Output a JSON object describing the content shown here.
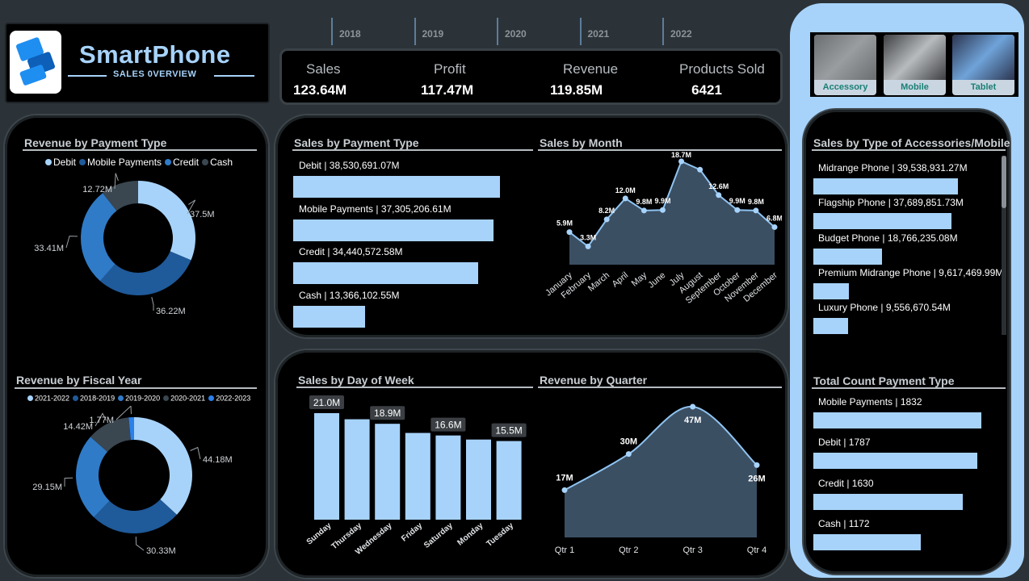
{
  "brand": {
    "title": "SmartPhone",
    "subtitle": "SALES 0VERVIEW"
  },
  "years": [
    "2018",
    "2019",
    "2020",
    "2021",
    "2022"
  ],
  "kpis": [
    {
      "label": "Sales",
      "value": "123.64M"
    },
    {
      "label": "Profit",
      "value": "117.47M"
    },
    {
      "label": "Revenue",
      "value": "119.85M"
    },
    {
      "label": "Products Sold",
      "value": "6421"
    }
  ],
  "categories": [
    {
      "label": "Accessory"
    },
    {
      "label": "Mobile"
    },
    {
      "label": "Tablet"
    }
  ],
  "revenue_payment": {
    "title": "Revenue by Payment Type",
    "legend": [
      "Debit",
      "Mobile Payments",
      "Credit",
      "Cash"
    ],
    "labels": [
      "37.5M",
      "36.22M",
      "33.41M",
      "12.72M"
    ]
  },
  "revenue_fiscal": {
    "title": "Revenue by Fiscal Year",
    "legend": [
      "2021-2022",
      "2018-2019",
      "2019-2020",
      "2020-2021",
      "2022-2023"
    ],
    "labels": [
      "44.18M",
      "30.33M",
      "29.15M",
      "14.42M",
      "1.77M"
    ]
  },
  "sales_payment": {
    "title": "Sales by Payment Type",
    "items": [
      {
        "label": "Debit | 38,530,691.07M",
        "value": 38530691.07
      },
      {
        "label": "Mobile Payments | 37,305,206.61M",
        "value": 37305206.61
      },
      {
        "label": "Credit | 34,440,572.58M",
        "value": 34440572.58
      },
      {
        "label": "Cash | 13,366,102.55M",
        "value": 13366102.55
      }
    ]
  },
  "sales_month": {
    "title": "Sales by Month"
  },
  "sales_accessories": {
    "title": "Sales by Type of Accessories/Mobile",
    "items": [
      {
        "label": "Midrange Phone | 39,538,931.27M",
        "value": 39538931.27
      },
      {
        "label": "Flagship Phone | 37,689,851.73M",
        "value": 37689851.73
      },
      {
        "label": "Budget Phone | 18,766,235.08M",
        "value": 18766235.08
      },
      {
        "label": "Premium Midrange Phone | 9,617,469.99M",
        "value": 9617469.99
      },
      {
        "label": "Luxury Phone | 9,556,670.54M",
        "value": 9556670.54
      }
    ]
  },
  "sales_dow": {
    "title": "Sales by Day of Week"
  },
  "revenue_quarter": {
    "title": "Revenue by Quarter"
  },
  "payment_count": {
    "title": "Total Count Payment Type",
    "items": [
      {
        "label": "Mobile Payments | 1832",
        "value": 1832
      },
      {
        "label": "Debit | 1787",
        "value": 1787
      },
      {
        "label": "Credit | 1630",
        "value": 1630
      },
      {
        "label": "Cash | 1172",
        "value": 1172
      }
    ]
  },
  "chart_data": [
    {
      "type": "pie",
      "title": "Revenue by Payment Type",
      "categories": [
        "Debit",
        "Mobile Payments",
        "Credit",
        "Cash"
      ],
      "values": [
        37.5,
        36.22,
        33.41,
        12.72
      ],
      "labels": [
        "37.5M",
        "36.22M",
        "33.41M",
        "12.72M"
      ],
      "colors": [
        "#a7d3fb",
        "#1f5a9a",
        "#2f7bc8",
        "#3a4650"
      ]
    },
    {
      "type": "pie",
      "title": "Revenue by Fiscal Year",
      "categories": [
        "2021-2022",
        "2018-2019",
        "2019-2020",
        "2020-2021",
        "2022-2023"
      ],
      "values": [
        44.18,
        30.33,
        29.15,
        14.42,
        1.77
      ],
      "labels": [
        "44.18M",
        "30.33M",
        "29.15M",
        "14.42M",
        "1.77M"
      ],
      "colors": [
        "#a7d3fb",
        "#1f5a9a",
        "#2f7bc8",
        "#3a4650",
        "#2b80ea"
      ]
    },
    {
      "type": "area",
      "title": "Sales by Month",
      "categories": [
        "January",
        "February",
        "March",
        "April",
        "May",
        "June",
        "July",
        "August",
        "September",
        "October",
        "November",
        "December"
      ],
      "values": [
        5.9,
        3.3,
        8.2,
        12.0,
        9.8,
        9.9,
        18.7,
        17.2,
        12.6,
        9.9,
        9.8,
        6.8
      ],
      "labels": [
        "5.9M",
        "3.3M",
        "8.2M",
        "12.0M",
        "9.8M",
        "9.9M",
        "18.7M",
        "",
        "12.6M",
        "9.9M",
        "9.8M",
        "6.8M"
      ]
    },
    {
      "type": "bar",
      "title": "Sales by Day of Week",
      "categories": [
        "Sunday",
        "Thursday",
        "Wednesday",
        "Friday",
        "Saturday",
        "Monday",
        "Tuesday"
      ],
      "values": [
        21.0,
        19.8,
        18.9,
        17.1,
        16.6,
        15.8,
        15.5
      ],
      "labels": [
        "21.0M",
        "",
        "18.9M",
        "",
        "16.6M",
        "",
        "15.5M"
      ]
    },
    {
      "type": "area",
      "title": "Revenue by Quarter",
      "categories": [
        "Qtr 1",
        "Qtr 2",
        "Qtr 3",
        "Qtr 4"
      ],
      "values": [
        17,
        30,
        47,
        26
      ],
      "labels": [
        "17M",
        "30M",
        "47M",
        "26M"
      ]
    }
  ]
}
